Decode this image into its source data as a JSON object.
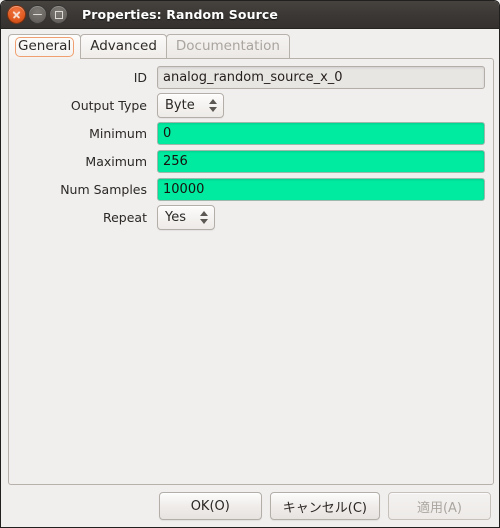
{
  "window": {
    "title": "Properties: Random Source",
    "controls": {
      "close": "close-icon",
      "minimize": "minimize-icon",
      "maximize": "maximize-icon"
    }
  },
  "tabs": [
    {
      "label": "General",
      "state": "active"
    },
    {
      "label": "Advanced",
      "state": "normal"
    },
    {
      "label": "Documentation",
      "state": "disabled"
    }
  ],
  "form": {
    "rows": [
      {
        "label": "ID",
        "type": "entry",
        "value": "analog_random_source_x_0",
        "style": "grey"
      },
      {
        "label": "Output Type",
        "type": "spinbox",
        "value": "Byte"
      },
      {
        "label": "Minimum",
        "type": "entry",
        "value": "0",
        "style": "green"
      },
      {
        "label": "Maximum",
        "type": "entry",
        "value": "256",
        "style": "green"
      },
      {
        "label": "Num Samples",
        "type": "entry",
        "value": "10000",
        "style": "green"
      },
      {
        "label": "Repeat",
        "type": "spinbox",
        "value": "Yes"
      }
    ]
  },
  "buttons": {
    "ok": "OK(O)",
    "cancel": "キャンセル(C)",
    "apply": "適用(A)"
  },
  "colors": {
    "titlebar": "#3b3835",
    "close_button": "#e25b20",
    "valid_field_green": "#00eba0",
    "window_background": "#f1efee",
    "focus_outline": "#f0a070"
  }
}
